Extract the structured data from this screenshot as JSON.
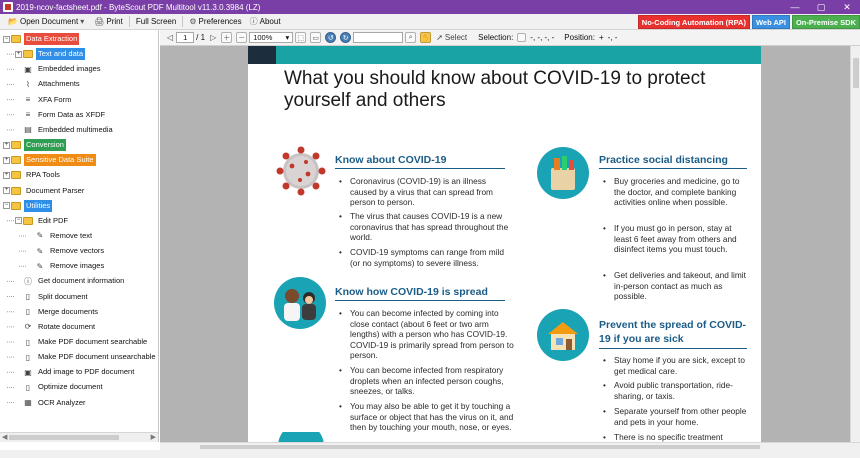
{
  "window": {
    "title": "2019-ncov-factsheet.pdf - ByteScout PDF Multitool v11.3.0.3984 (LZ)",
    "controls": [
      "—",
      "▢",
      "✕"
    ]
  },
  "toolbar": {
    "open_label": "Open Document",
    "print_label": "Print",
    "fullscreen_label": "Full Screen",
    "preferences_label": "Preferences",
    "about_label": "About"
  },
  "badges": [
    {
      "label": "No-Coding Automation (RPA)",
      "color": "#e8312f"
    },
    {
      "label": "Web API",
      "color": "#3a8fe0"
    },
    {
      "label": "On-Premise SDK",
      "color": "#4caf50"
    }
  ],
  "sidebar": {
    "items": [
      {
        "label": "Data Extraction",
        "style": "hl-red",
        "level": 0,
        "expander": "−",
        "icon": "folder"
      },
      {
        "label": "Text and data",
        "style": "hl-blue",
        "level": 1,
        "expander": "+",
        "icon": "folder"
      },
      {
        "label": "Embedded images",
        "style": "",
        "level": 1,
        "expander": "",
        "icon": "image"
      },
      {
        "label": "Attachments",
        "style": "",
        "level": 1,
        "expander": "",
        "icon": "paperclip"
      },
      {
        "label": "XFA Form",
        "style": "",
        "level": 1,
        "expander": "",
        "icon": "form"
      },
      {
        "label": "Form Data as XFDF",
        "style": "",
        "level": 1,
        "expander": "",
        "icon": "form"
      },
      {
        "label": "Embedded multimedia",
        "style": "",
        "level": 1,
        "expander": "",
        "icon": "film"
      },
      {
        "label": "Conversion",
        "style": "hl-green",
        "level": 0,
        "expander": "+",
        "icon": "folder"
      },
      {
        "label": "Sensitive Data Suite",
        "style": "hl-orange",
        "level": 0,
        "expander": "+",
        "icon": "folder"
      },
      {
        "label": "RPA Tools",
        "style": "",
        "level": 0,
        "expander": "+",
        "icon": "folder"
      },
      {
        "label": "Document Parser",
        "style": "",
        "level": 0,
        "expander": "+",
        "icon": "folder"
      },
      {
        "label": "Utilities",
        "style": "hl-blue",
        "level": 0,
        "expander": "−",
        "icon": "folder"
      },
      {
        "label": "Edit PDF",
        "style": "",
        "level": 1,
        "expander": "−",
        "icon": "folder"
      },
      {
        "label": "Remove text",
        "style": "",
        "level": 2,
        "expander": "",
        "icon": "edit"
      },
      {
        "label": "Remove vectors",
        "style": "",
        "level": 2,
        "expander": "",
        "icon": "edit"
      },
      {
        "label": "Remove images",
        "style": "",
        "level": 2,
        "expander": "",
        "icon": "edit"
      },
      {
        "label": "Get document information",
        "style": "",
        "level": 1,
        "expander": "",
        "icon": "info"
      },
      {
        "label": "Split document",
        "style": "",
        "level": 1,
        "expander": "",
        "icon": "pdf"
      },
      {
        "label": "Merge documents",
        "style": "",
        "level": 1,
        "expander": "",
        "icon": "pdf"
      },
      {
        "label": "Rotate document",
        "style": "",
        "level": 1,
        "expander": "",
        "icon": "rotate"
      },
      {
        "label": "Make PDF document searchable",
        "style": "",
        "level": 1,
        "expander": "",
        "icon": "pdf"
      },
      {
        "label": "Make PDF document unsearchable",
        "style": "",
        "level": 1,
        "expander": "",
        "icon": "pdf"
      },
      {
        "label": "Add image to PDF document",
        "style": "",
        "level": 1,
        "expander": "",
        "icon": "image"
      },
      {
        "label": "Optimize document",
        "style": "",
        "level": 1,
        "expander": "",
        "icon": "pdf"
      },
      {
        "label": "OCR Analyzer",
        "style": "",
        "level": 1,
        "expander": "",
        "icon": "ocr"
      }
    ]
  },
  "viewer": {
    "page_current": "1",
    "page_total": "/ 1",
    "zoom": "100%",
    "search_value": "",
    "select_label": "Select",
    "selection_label": "Selection:",
    "selection_value": "-, -, -, -",
    "position_label": "Position:",
    "position_value": "-, -"
  },
  "document": {
    "headline": "What you should know about COVID-19 to protect yourself and others",
    "sections": [
      {
        "title": "Know about COVID-19",
        "bullets": [
          "Coronavirus (COVID-19) is an illness caused by a virus that can spread from person to person.",
          "The virus that causes COVID-19 is a new coronavirus that has spread throughout the world.",
          "COVID-19 symptoms can range from mild (or no symptoms) to severe illness."
        ]
      },
      {
        "title": "Know how COVID-19 is spread",
        "bullets": [
          "You can become infected by coming into close contact (about 6 feet or two arm lengths) with a person who has COVID-19. COVID-19 is primarily spread from person to person.",
          "You can become infected from respiratory droplets when an infected person coughs, sneezes, or talks.",
          "You may also be able to get it by touching a surface or object that has the virus on it, and then by touching your mouth, nose, or eyes."
        ]
      },
      {
        "title": "Practice social distancing",
        "bullets": [
          "Buy groceries and medicine, go to the doctor, and complete banking activities online when possible.",
          "If you must go in person, stay at least 6 feet away from others and disinfect items you must touch.",
          "Get deliveries and takeout, and limit in-person contact as much as possible."
        ]
      },
      {
        "title": "Prevent the spread of COVID-19 if you are sick",
        "bullets": [
          "Stay home if you are sick, except to get medical care.",
          "Avoid public transportation, ride-sharing, or taxis.",
          "Separate yourself from other people and pets in your home.",
          "There is no specific treatment"
        ]
      }
    ]
  },
  "colors": {
    "titlebar": "#7a3fa6",
    "doc_accent_teal": "#19a3a5",
    "doc_accent_navy": "#1c2d3d",
    "section_heading": "#1b5c87"
  }
}
